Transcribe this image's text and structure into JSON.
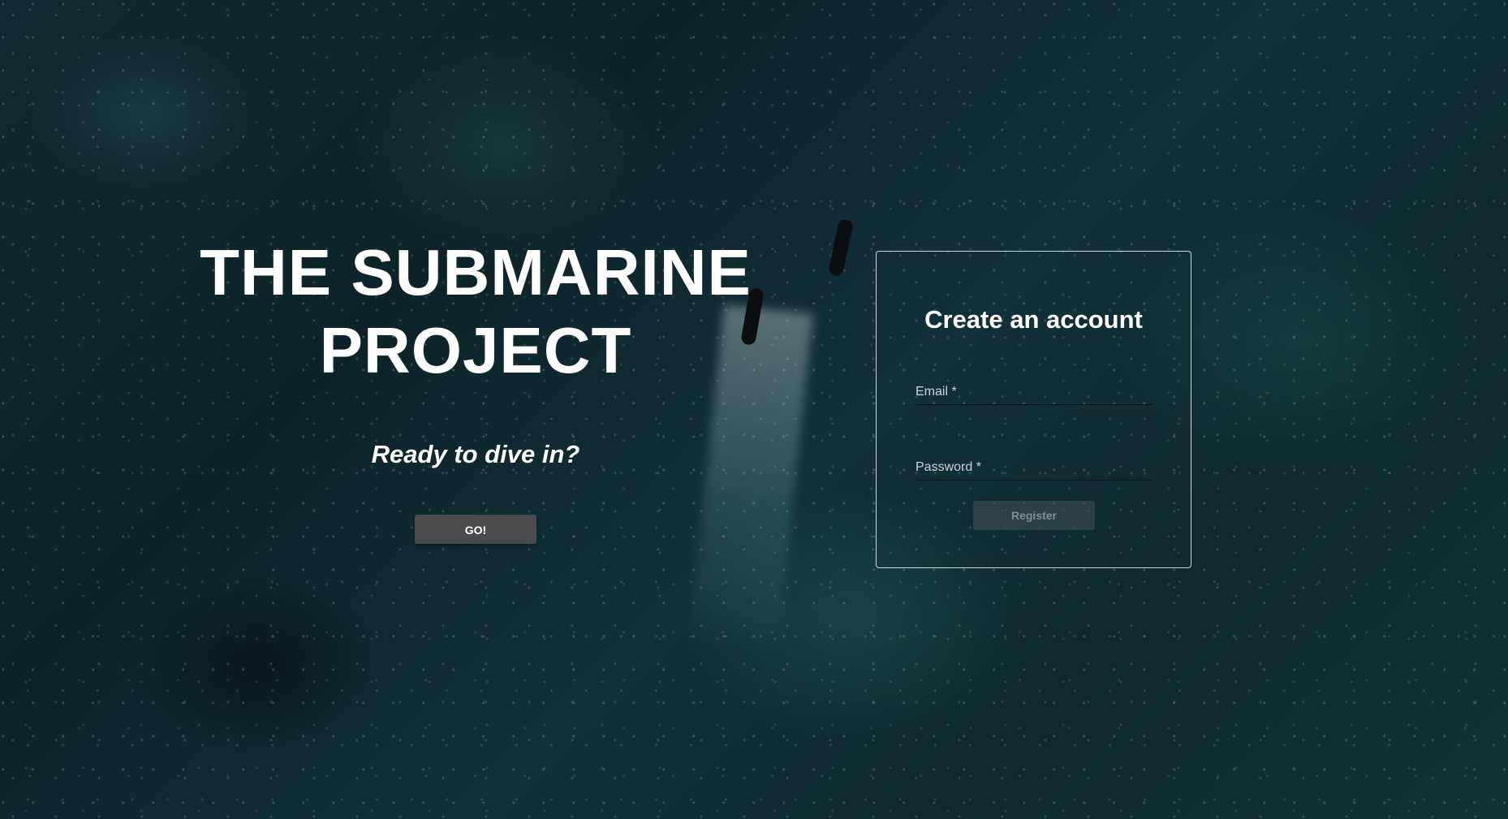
{
  "hero": {
    "title_line1": "THE SUBMARINE",
    "title_line2": "PROJECT",
    "tagline": "Ready to dive in?",
    "go_label": "GO!"
  },
  "register_card": {
    "title": "Create an account",
    "email_label": "Email *",
    "password_label": "Password *",
    "register_label": "Register"
  }
}
